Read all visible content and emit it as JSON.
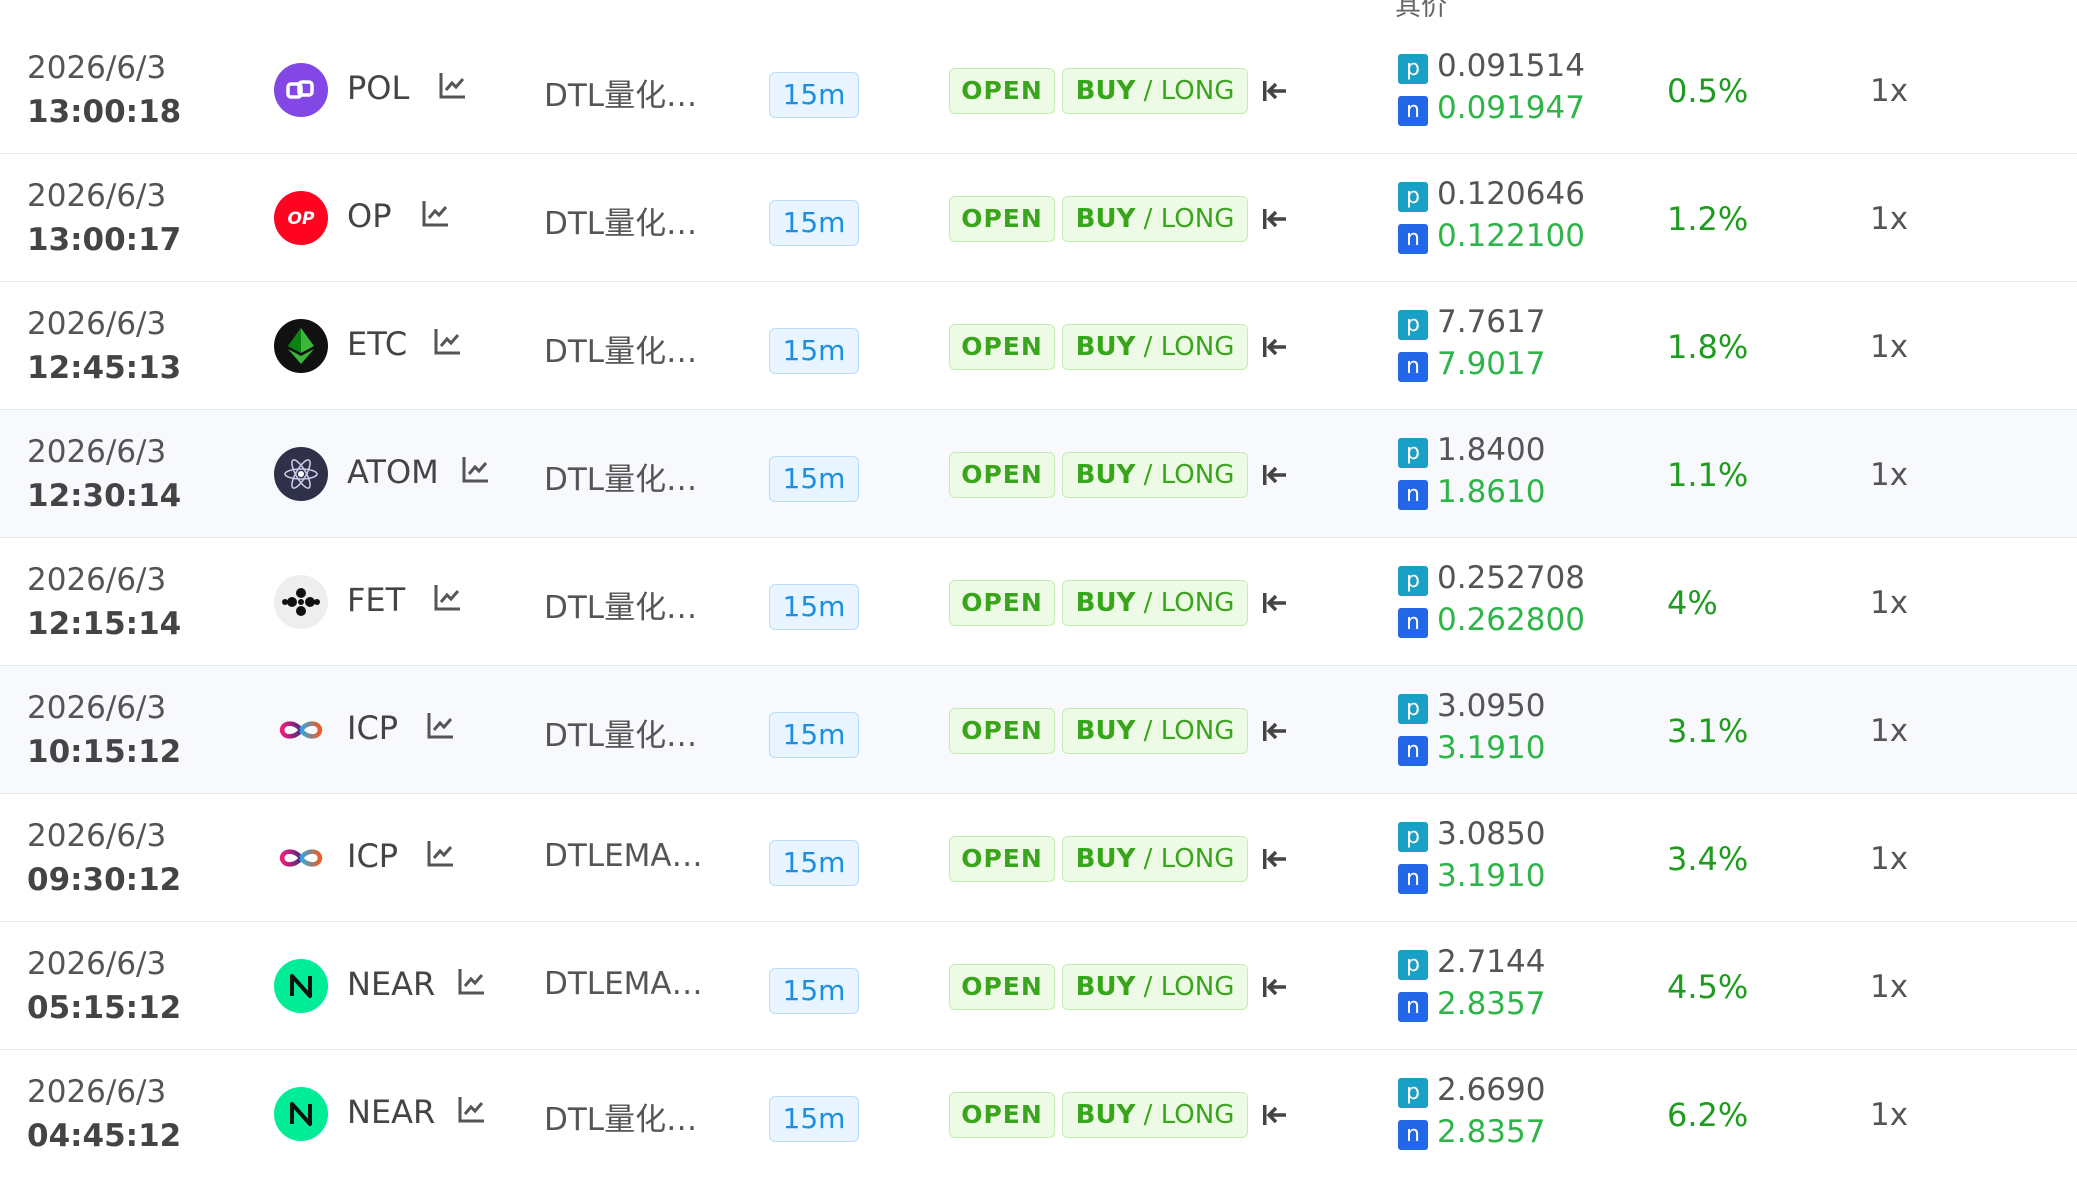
{
  "header": {
    "clipped_text": "其价"
  },
  "colors": {
    "accent_green": "#2fb44a",
    "tag_green": "#39a51c",
    "timeframe_blue": "#1a8fe3",
    "badge_p": "#1aa0c8",
    "badge_n": "#2366e6"
  },
  "rows": [
    {
      "date": "2026/6/3",
      "time": "13:00:18",
      "coin": "POL",
      "icon": "polygon-icon",
      "strategy": "DTL量化…",
      "timeframe": "15m",
      "action": "OPEN",
      "side_bold": "BUY",
      "side_sep": " / ",
      "side_rest": "LONG",
      "p_badge": "p",
      "p_price": "0.091514",
      "n_badge": "n",
      "n_price": "0.091947",
      "pct": "0.5%",
      "leverage": "1x"
    },
    {
      "date": "2026/6/3",
      "time": "13:00:17",
      "coin": "OP",
      "icon": "optimism-icon",
      "strategy": "DTL量化…",
      "timeframe": "15m",
      "action": "OPEN",
      "side_bold": "BUY",
      "side_sep": " / ",
      "side_rest": "LONG",
      "p_badge": "p",
      "p_price": "0.120646",
      "n_badge": "n",
      "n_price": "0.122100",
      "pct": "1.2%",
      "leverage": "1x"
    },
    {
      "date": "2026/6/3",
      "time": "12:45:13",
      "coin": "ETC",
      "icon": "ethereum-classic-icon",
      "strategy": "DTL量化…",
      "timeframe": "15m",
      "action": "OPEN",
      "side_bold": "BUY",
      "side_sep": " / ",
      "side_rest": "LONG",
      "p_badge": "p",
      "p_price": "7.7617",
      "n_badge": "n",
      "n_price": "7.9017",
      "pct": "1.8%",
      "leverage": "1x"
    },
    {
      "date": "2026/6/3",
      "time": "12:30:14",
      "coin": "ATOM",
      "icon": "cosmos-icon",
      "strategy": "DTL量化…",
      "timeframe": "15m",
      "action": "OPEN",
      "side_bold": "BUY",
      "side_sep": " / ",
      "side_rest": "LONG",
      "p_badge": "p",
      "p_price": "1.8400",
      "n_badge": "n",
      "n_price": "1.8610",
      "pct": "1.1%",
      "leverage": "1x"
    },
    {
      "date": "2026/6/3",
      "time": "12:15:14",
      "coin": "FET",
      "icon": "fetch-ai-icon",
      "strategy": "DTL量化…",
      "timeframe": "15m",
      "action": "OPEN",
      "side_bold": "BUY",
      "side_sep": " / ",
      "side_rest": "LONG",
      "p_badge": "p",
      "p_price": "0.252708",
      "n_badge": "n",
      "n_price": "0.262800",
      "pct": "4%",
      "leverage": "1x"
    },
    {
      "date": "2026/6/3",
      "time": "10:15:12",
      "coin": "ICP",
      "icon": "internet-computer-icon",
      "strategy": "DTL量化…",
      "timeframe": "15m",
      "action": "OPEN",
      "side_bold": "BUY",
      "side_sep": " / ",
      "side_rest": "LONG",
      "p_badge": "p",
      "p_price": "3.0950",
      "n_badge": "n",
      "n_price": "3.1910",
      "pct": "3.1%",
      "leverage": "1x"
    },
    {
      "date": "2026/6/3",
      "time": "09:30:12",
      "coin": "ICP",
      "icon": "internet-computer-icon",
      "strategy": "DTLEMA…",
      "timeframe": "15m",
      "action": "OPEN",
      "side_bold": "BUY",
      "side_sep": " / ",
      "side_rest": "LONG",
      "p_badge": "p",
      "p_price": "3.0850",
      "n_badge": "n",
      "n_price": "3.1910",
      "pct": "3.4%",
      "leverage": "1x"
    },
    {
      "date": "2026/6/3",
      "time": "05:15:12",
      "coin": "NEAR",
      "icon": "near-icon",
      "strategy": "DTLEMA…",
      "timeframe": "15m",
      "action": "OPEN",
      "side_bold": "BUY",
      "side_sep": " / ",
      "side_rest": "LONG",
      "p_badge": "p",
      "p_price": "2.7144",
      "n_badge": "n",
      "n_price": "2.8357",
      "pct": "4.5%",
      "leverage": "1x"
    },
    {
      "date": "2026/6/3",
      "time": "04:45:12",
      "coin": "NEAR",
      "icon": "near-icon",
      "strategy": "DTL量化…",
      "timeframe": "15m",
      "action": "OPEN",
      "side_bold": "BUY",
      "side_sep": " / ",
      "side_rest": "LONG",
      "p_badge": "p",
      "p_price": "2.6690",
      "n_badge": "n",
      "n_price": "2.8357",
      "pct": "6.2%",
      "leverage": "1x"
    }
  ]
}
